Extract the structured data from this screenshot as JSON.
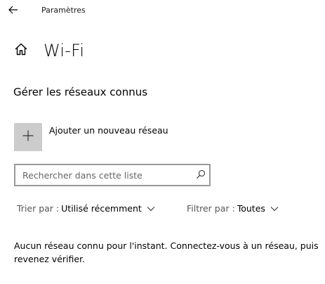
{
  "window": {
    "title": "Paramètres"
  },
  "header": {
    "title": "Wi-Fi"
  },
  "section": {
    "title": "Gérer les réseaux connus"
  },
  "add_network": {
    "label": "Ajouter un nouveau réseau"
  },
  "search": {
    "placeholder": "Rechercher dans cette liste",
    "value": ""
  },
  "sort": {
    "label": "Trier par :",
    "value": "Utilisé récemment"
  },
  "filter": {
    "label": "Filtrer par :",
    "value": "Toutes"
  },
  "empty_message": "Aucun réseau connu pour l'instant. Connectez-vous à un réseau, puis revenez vérifier.",
  "icons": {
    "back": "arrow-left-icon",
    "home": "home-icon",
    "add": "plus-icon",
    "search": "search-icon",
    "dropdown": "chevron-down-icon"
  },
  "colors": {
    "add_tile_bg": "#cccccc",
    "search_border": "#999999",
    "secondary_text": "#555555"
  }
}
